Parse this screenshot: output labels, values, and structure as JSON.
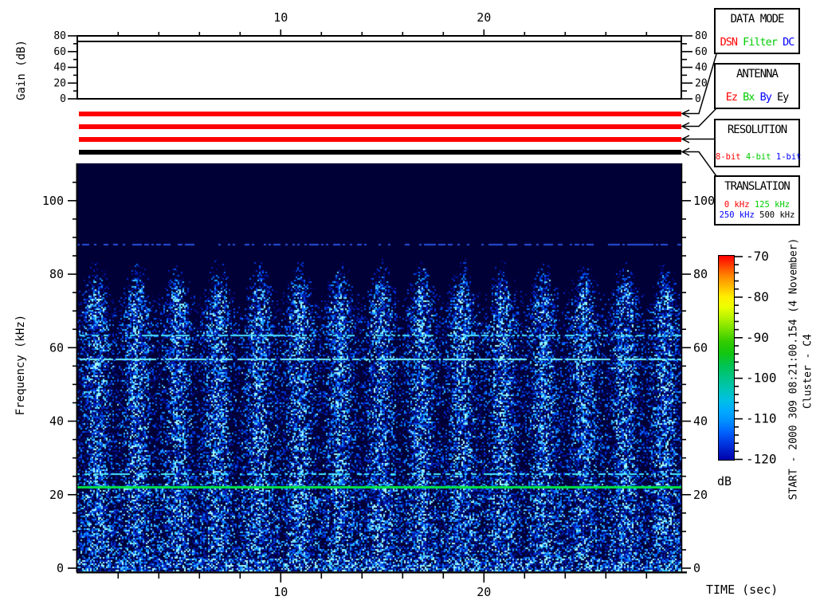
{
  "gain_plot": {
    "ylabel": "Gain (dB)",
    "ylim": [
      0,
      80
    ],
    "ytick_labels": [
      "0",
      "20",
      "40",
      "60",
      "80"
    ],
    "ytick_values": [
      0,
      20,
      40,
      60,
      80
    ],
    "minor_tick_values": [
      10,
      30,
      50,
      70
    ],
    "gain_line_db": 73
  },
  "time_axis": {
    "label": "TIME (sec)",
    "major_tick_labels": [
      "10",
      "20"
    ],
    "major_tick_values": [
      10,
      20
    ],
    "minor_tick_values": [
      2,
      4,
      6,
      8,
      12,
      14,
      16,
      18,
      22,
      24,
      26,
      28
    ],
    "range_sec": [
      0,
      29.7
    ]
  },
  "freq_axis": {
    "label": "Frequency (kHz)",
    "tick_labels": [
      "0",
      "20",
      "40",
      "60",
      "80",
      "100"
    ],
    "tick_values": [
      0,
      20,
      40,
      60,
      80,
      100
    ],
    "minor_step_khz": 5,
    "range_khz": [
      0,
      110
    ]
  },
  "status_bars": {
    "colors": [
      "#ff0000",
      "#ff0000",
      "#ff0000",
      "#000000"
    ]
  },
  "panels": [
    {
      "id": "data-mode",
      "title": "DATA MODE",
      "items": [
        {
          "text": "DSN",
          "color": "#ff0000"
        },
        {
          "text": "Filter",
          "color": "#00cc00"
        },
        {
          "text": "DC",
          "color": "#0000ff"
        }
      ]
    },
    {
      "id": "antenna",
      "title": "ANTENNA",
      "items": [
        {
          "text": "Ez",
          "color": "#ff0000"
        },
        {
          "text": "Bx",
          "color": "#00cc00"
        },
        {
          "text": "By",
          "color": "#0000ff"
        },
        {
          "text": "Ey",
          "color": "#000000"
        }
      ]
    },
    {
      "id": "resolution",
      "title": "RESOLUTION",
      "items": [
        {
          "text": "8-bit",
          "color": "#ff0000"
        },
        {
          "text": "4-bit",
          "color": "#00cc00"
        },
        {
          "text": "1-bit",
          "color": "#0000ff"
        }
      ]
    },
    {
      "id": "translation",
      "title": "TRANSLATION",
      "rows": [
        [
          {
            "text": "0 kHz",
            "color": "#ff0000"
          },
          {
            "text": "125 kHz",
            "color": "#00cc00"
          }
        ],
        [
          {
            "text": "250 kHz",
            "color": "#0000ff"
          },
          {
            "text": "500 kHz",
            "color": "#000000"
          }
        ]
      ]
    }
  ],
  "colorbar": {
    "unit_label": "dB",
    "tick_labels": [
      "-70",
      "-80",
      "-90",
      "-100",
      "-110",
      "-120"
    ],
    "tick_values": [
      -70,
      -80,
      -90,
      -100,
      -110,
      -120
    ],
    "minor_step_db": 2,
    "gradient_stops": [
      [
        0.0,
        "#ff0000"
      ],
      [
        0.05,
        "#ff4400"
      ],
      [
        0.1,
        "#ff8800"
      ],
      [
        0.15,
        "#ffbb00"
      ],
      [
        0.2,
        "#ffee00"
      ],
      [
        0.25,
        "#eeff00"
      ],
      [
        0.3,
        "#bbf400"
      ],
      [
        0.36,
        "#77e200"
      ],
      [
        0.42,
        "#33cc00"
      ],
      [
        0.48,
        "#11c611"
      ],
      [
        0.54,
        "#00c455"
      ],
      [
        0.6,
        "#00c489"
      ],
      [
        0.66,
        "#00c4bb"
      ],
      [
        0.71,
        "#00c0e6"
      ],
      [
        0.76,
        "#00aaff"
      ],
      [
        0.81,
        "#0090ff"
      ],
      [
        0.86,
        "#0066ff"
      ],
      [
        0.92,
        "#0036e0"
      ],
      [
        1.0,
        "#0000aa"
      ]
    ]
  },
  "side_text": {
    "start_line": "START - 2000 309 08:21:00.154 (4 November)",
    "spacecraft_line": "Cluster - C4"
  },
  "chart_data": {
    "type": "heatmap",
    "title": "Wideband spectrogram with gain strip chart",
    "xlabel": "TIME (sec)",
    "ylabel": "Frequency (kHz)",
    "xlim": [
      0,
      29.7
    ],
    "ylim": [
      0,
      110
    ],
    "color_scale": {
      "label": "dB",
      "min": -120,
      "max": -70,
      "colormap": "rainbow"
    },
    "gain_db": 73,
    "background_level_db": -120,
    "broadband_noise_top_khz": 85,
    "pulse_period_sec": 2.0,
    "pulse_count": 15,
    "spectral_lines": [
      {
        "freq_khz": 88.3,
        "appearance": "faint dotted",
        "color": "#2850dc"
      },
      {
        "freq_khz": 63.5,
        "appearance": "dotted",
        "color": "#48dcff"
      },
      {
        "freq_khz": 57.0,
        "appearance": "dashed bright",
        "color": "#70f0ff"
      },
      {
        "freq_khz": 25.7,
        "appearance": "dashed",
        "color": "#48e8ff"
      },
      {
        "freq_khz": 22.2,
        "appearance": "solid",
        "color": "#00e446"
      }
    ]
  }
}
